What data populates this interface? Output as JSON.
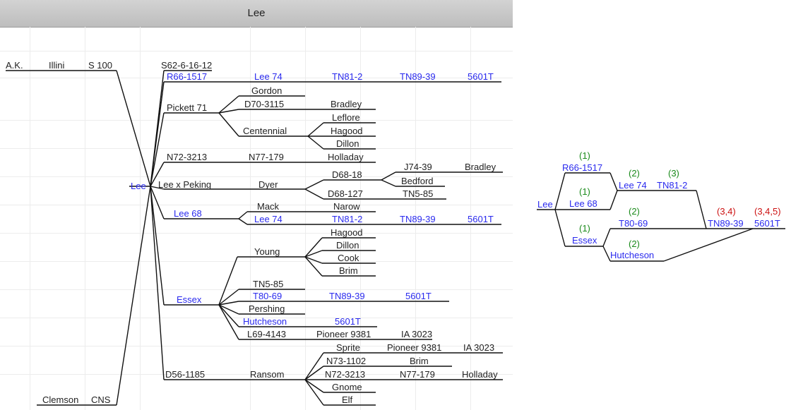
{
  "header": {
    "title": "Lee"
  },
  "left_tree": {
    "root": "Lee",
    "ancestors": [
      "A.K.",
      "Illini",
      "S 100",
      "Clemson",
      "CNS"
    ],
    "parents": {
      "s62": "S62-6-16-12",
      "pickett": "Pickett 71",
      "n72": "N72-3213",
      "leepeking": "Lee x Peking",
      "lee68": "Lee 68",
      "essex": "Essex",
      "d56": "D56-1185"
    },
    "r66_line": [
      "R66-1517",
      "Lee 74",
      "TN81-2",
      "TN89-39",
      "5601T"
    ],
    "pickett_children": {
      "gordon": "Gordon",
      "d70": "D70-3115",
      "bradley": "Bradley",
      "centennial": "Centennial",
      "leflore": "Leflore",
      "hagood": "Hagood",
      "dillon": "Dillon"
    },
    "n72_line": [
      "N77-179",
      "Holladay"
    ],
    "peking_line": {
      "dyer": "Dyer",
      "d68_18": "D68-18",
      "j74": "J74-39",
      "bradley": "Bradley",
      "bedford": "Bedford",
      "d68_127": "D68-127",
      "tn5": "TN5-85"
    },
    "lee68_line": {
      "mack": "Mack",
      "narow": "Narow",
      "lee74": "Lee 74",
      "tn81": "TN81-2",
      "tn89": "TN89-39",
      "t5601": "5601T"
    },
    "essex_line": {
      "young": "Young",
      "hagood": "Hagood",
      "dillon": "Dillon",
      "cook": "Cook",
      "brim": "Brim",
      "tn5": "TN5-85",
      "t80": "T80-69",
      "tn89": "TN89-39",
      "t5601a": "5601T",
      "pershing": "Pershing",
      "hutcheson": "Hutcheson",
      "t5601b": "5601T",
      "l69": "L69-4143",
      "pioneer": "Pioneer 9381",
      "ia": "IA 3023"
    },
    "d56_line": {
      "ransom": "Ransom",
      "sprite": "Sprite",
      "pioneer": "Pioneer 9381",
      "ia": "IA 3023",
      "n73": "N73-1102",
      "brim": "Brim",
      "n72": "N72-3213",
      "n77": "N77-179",
      "holladay": "Holladay",
      "gnome": "Gnome",
      "elf": "Elf"
    }
  },
  "right_tree": {
    "nodes": {
      "lee": "Lee",
      "r66": "R66-1517",
      "lee68": "Lee 68",
      "lee74": "Lee 74",
      "tn81": "TN81-2",
      "t80": "T80-69",
      "essex": "Essex",
      "hutcheson": "Hutcheson",
      "tn89": "TN89-39",
      "t5601": "5601T"
    },
    "tags": {
      "r66": "(1)",
      "lee68": "(1)",
      "lee74": "(2)",
      "tn81": "(3)",
      "essex": "(1)",
      "t80": "(2)",
      "hutcheson": "(2)",
      "tn89": "(3,4)",
      "t5601": "(3,4,5)"
    },
    "colors": {
      "label": "#2a2aee",
      "gen": "#1a8a1a",
      "multi": "#cc1111"
    }
  }
}
